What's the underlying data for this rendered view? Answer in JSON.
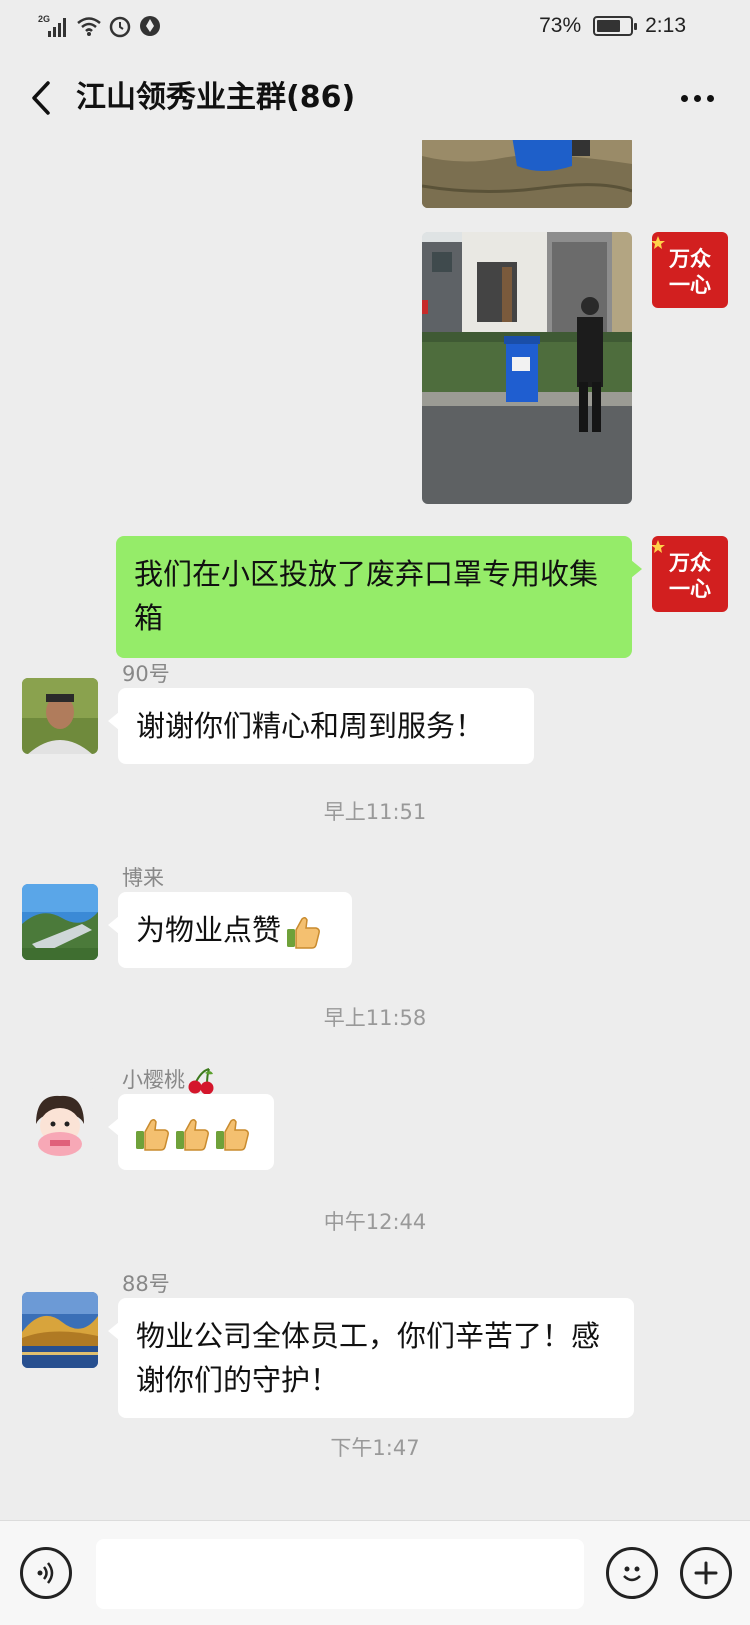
{
  "status_bar": {
    "network": "2G",
    "battery_text": "73%",
    "battery_level": 0.73,
    "time": "2:13"
  },
  "nav": {
    "title": "江山领秀业主群(86)",
    "back_icon": "chevron-left-icon",
    "more_icon": "more-horizontal-icon"
  },
  "messages": [
    {
      "type": "image",
      "side": "right",
      "content": "photo-cropped-top"
    },
    {
      "type": "image",
      "side": "right",
      "content": "photo-mask-collection-bin"
    },
    {
      "type": "text",
      "side": "right",
      "text": "我们在小区投放了废弃口罩专用收集箱"
    },
    {
      "type": "text",
      "side": "left",
      "sender": "90号",
      "text": "谢谢你们精心和周到服务！"
    },
    {
      "type": "time",
      "text": "早上11:51"
    },
    {
      "type": "text",
      "side": "left",
      "sender": "博来",
      "text": "为物业点赞"
    },
    {
      "type": "time",
      "text": "早上11:58"
    },
    {
      "type": "text",
      "side": "left",
      "sender": "小樱桃",
      "text": ""
    },
    {
      "type": "time",
      "text": "中午12:44"
    },
    {
      "type": "text",
      "side": "left",
      "sender": "88号",
      "text": "物业公司全体员工，你们辛苦了！感谢你们的守护！"
    },
    {
      "type": "time",
      "text": "下午1:47"
    }
  ],
  "avatar_logo_text": "万众一心",
  "colors": {
    "bubble_green": "#95ec69",
    "background": "#ededed"
  },
  "input_bar": {
    "voice_icon": "voice-icon",
    "emoji_icon": "emoji-icon",
    "plus_icon": "plus-icon",
    "input_value": ""
  }
}
